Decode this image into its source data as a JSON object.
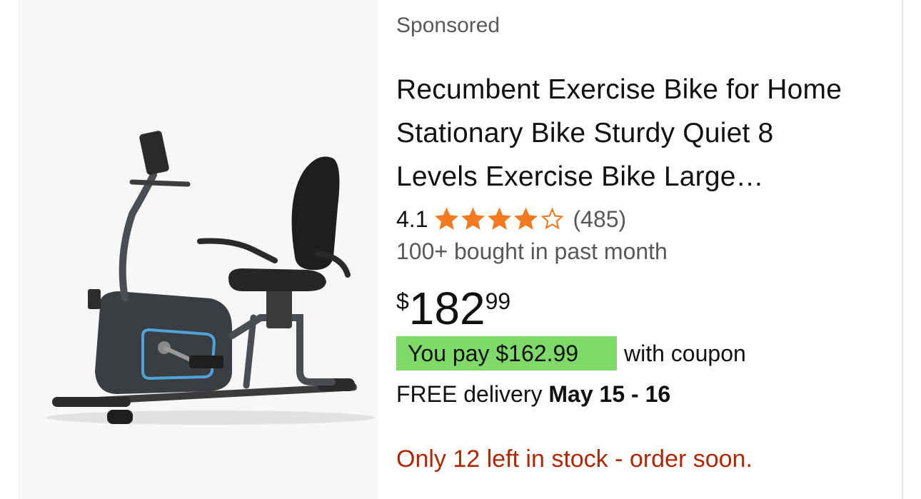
{
  "product": {
    "sponsored_label": "Sponsored",
    "title_lines": [
      "Recumbent Exercise Bike for Home",
      "Stationary Bike Sturdy Quiet 8",
      "Levels Exercise Bike Large…"
    ],
    "rating": {
      "value": "4.1",
      "stars_filled_fraction": 0.82,
      "review_count": "(485)",
      "star_color": "#f47a20"
    },
    "bought_text": "100+ bought in past month",
    "price": {
      "symbol": "$",
      "whole": "182",
      "fraction": "99"
    },
    "coupon": {
      "badge_text": "You pay $162.99",
      "suffix_text": "with coupon",
      "badge_color": "#7fda69"
    },
    "delivery": {
      "prefix": "FREE delivery ",
      "date": "May 15 - 16"
    },
    "stock_text": "Only 12 left in stock - order soon.",
    "stock_color": "#b12704",
    "image_icon": "recumbent-bike-image"
  }
}
